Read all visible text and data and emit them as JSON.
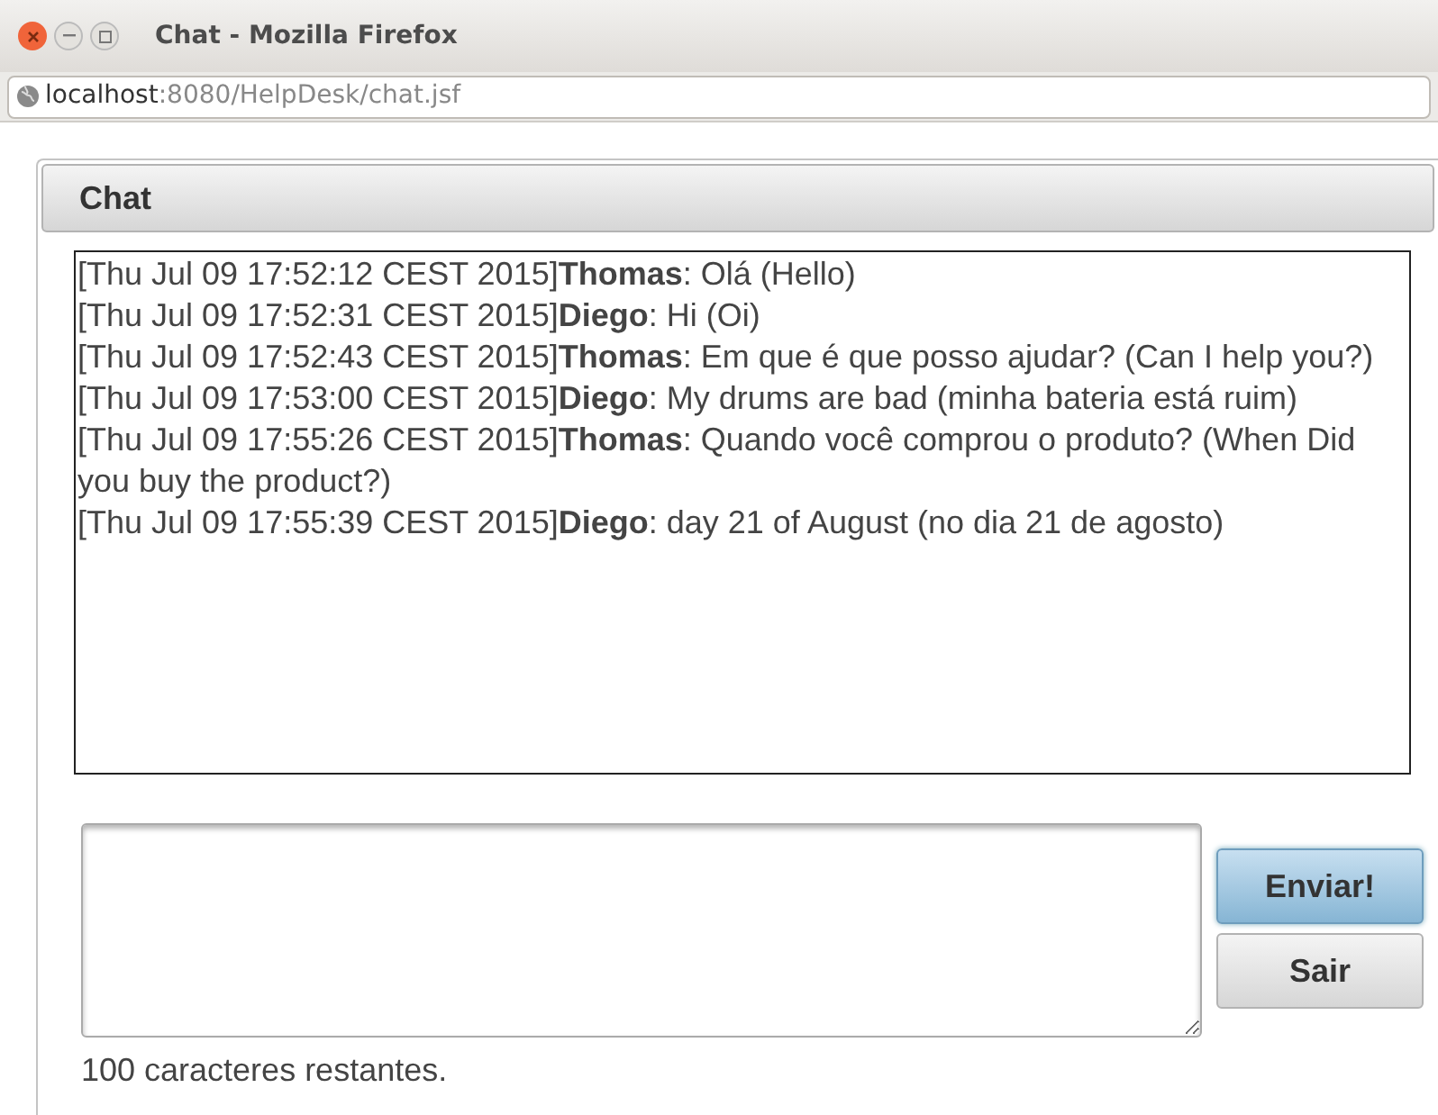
{
  "window": {
    "title": "Chat - Mozilla Firefox"
  },
  "address_bar": {
    "host": "localhost",
    "path": ":8080/HelpDesk/chat.jsf"
  },
  "panel": {
    "title": "Chat"
  },
  "messages": [
    "[Thu Jul 09 17:52:12 CEST 2015]**Thomas**: Olá (Hello)",
    "[Thu Jul 09 17:52:31 CEST 2015]**Diego**: Hi (Oi)",
    "[Thu Jul 09 17:52:43 CEST 2015]**Thomas**: Em que é que posso ajudar? (Can I help you?)",
    "[Thu Jul 09 17:53:00 CEST 2015]**Diego**: My drums are bad (minha bateria está ruim)",
    "[Thu Jul 09 17:55:26 CEST 2015]**Thomas**: Quando você comprou o produto? (When Did you buy the product?)",
    "[Thu Jul 09 17:55:39 CEST 2015]**Diego**: day 21 of August (no dia 21 de agosto)"
  ],
  "buttons": [
    {
      "label": "Enviar!",
      "highlighted": true
    },
    {
      "label": "Sair",
      "highlighted": false
    }
  ],
  "counter": "100 caracteres restantes."
}
